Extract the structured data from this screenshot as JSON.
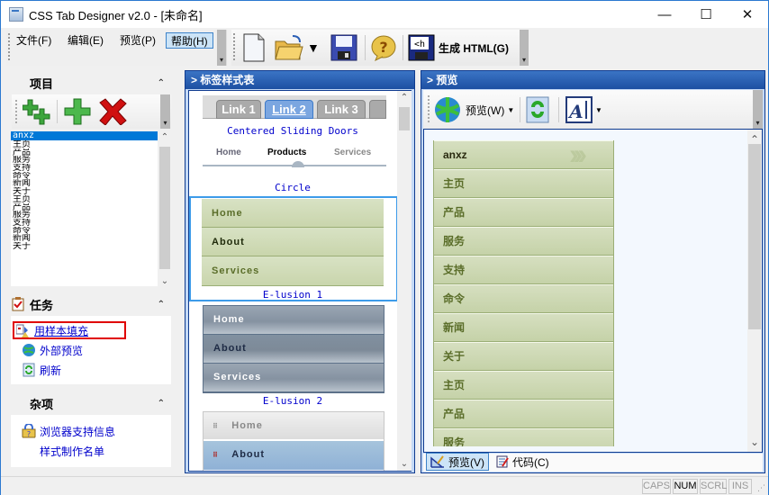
{
  "window": {
    "title": "CSS Tab Designer v2.0 - [未命名]",
    "controls": {
      "minimize": "—",
      "maximize": "☐",
      "close": "✕"
    }
  },
  "menubar": {
    "items": [
      {
        "label": "文件(F)",
        "active": false
      },
      {
        "label": "编辑(E)",
        "active": false
      },
      {
        "label": "预览(P)",
        "active": false
      },
      {
        "label": "帮助(H)",
        "active": true
      }
    ]
  },
  "toolbar": {
    "buttons": [
      {
        "name": "new-icon"
      },
      {
        "name": "open-icon"
      },
      {
        "name": "save-icon"
      },
      {
        "name": "help-icon"
      }
    ],
    "generate_label": "生成 HTML(G)"
  },
  "left_panel": {
    "items_section": {
      "title": "项目",
      "list": [
        "anxz",
        "主页",
        "产品",
        "服务",
        "支持",
        "命令",
        "新闻",
        "关于",
        "主页",
        "产品",
        "服务",
        "支持",
        "命令",
        "新闻",
        "关于"
      ],
      "selected_index": 0
    },
    "tasks_section": {
      "title": "任务",
      "links": [
        "用样本填充",
        "外部预览",
        "刷新"
      ]
    },
    "misc_section": {
      "title": "杂项",
      "links": [
        "浏览器支持信息",
        "样式制作名单"
      ]
    }
  },
  "stylesheet_panel": {
    "title": "> 标签样式表",
    "tabs_preview": [
      "Link 1",
      "Link 2",
      "Link 3"
    ],
    "styles": [
      {
        "name": "Centered Sliding Doors",
        "items": [
          "Home",
          "Products",
          "Services"
        ]
      },
      {
        "name": "Circle",
        "items": [
          "Home",
          "About",
          "Services"
        ]
      },
      {
        "name": "E-lusion 1",
        "items": [
          "Home",
          "About",
          "Services"
        ]
      },
      {
        "name": "E-lusion 2",
        "items": [
          "Home",
          "About"
        ]
      }
    ],
    "selected_style": "Circle"
  },
  "preview_panel": {
    "title": "> 预览",
    "preview_button": "预览(W)",
    "menu_items": [
      "anxz",
      "主页",
      "产品",
      "服务",
      "支持",
      "命令",
      "新闻",
      "关于",
      "主页",
      "产品",
      "服务"
    ],
    "bottom_tabs": [
      {
        "label": "预览(V)",
        "active": true
      },
      {
        "label": "代码(C)",
        "active": false
      }
    ]
  },
  "statusbar": {
    "indicators": [
      {
        "label": "CAPS",
        "on": false
      },
      {
        "label": "NUM",
        "on": true
      },
      {
        "label": "SCRL",
        "on": false
      },
      {
        "label": "INS",
        "on": false
      }
    ]
  },
  "colors": {
    "accent": "#1d4fa2",
    "selection": "#0078d7",
    "link": "#0000cc",
    "highlight_box": "#e00000"
  }
}
